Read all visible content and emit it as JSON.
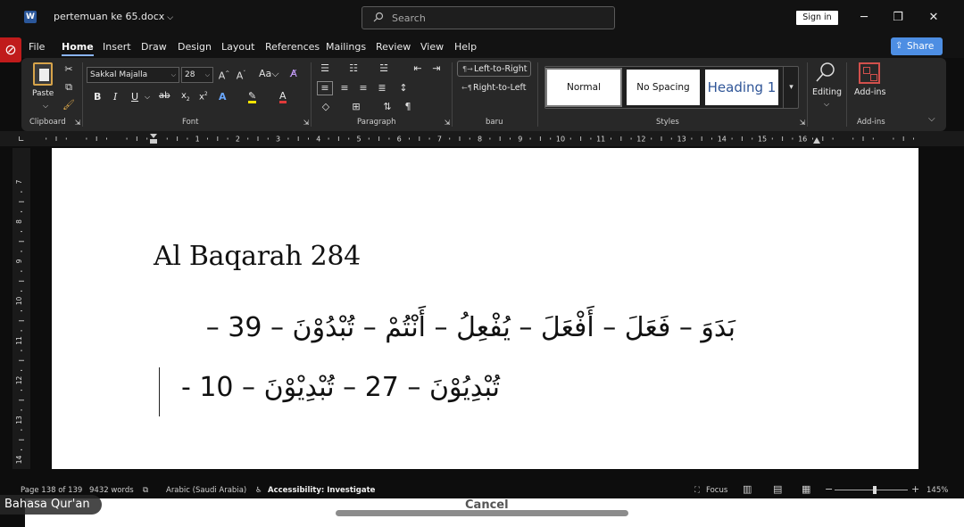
{
  "titlebar": {
    "app_icon": "word-icon",
    "doc_title": "pertemuan ke 65.docx",
    "search_placeholder": "Search",
    "signin_label": "Sign in"
  },
  "menu": {
    "items": [
      "File",
      "Home",
      "Insert",
      "Draw",
      "Design",
      "Layout",
      "References",
      "Mailings",
      "Review",
      "View",
      "Help"
    ],
    "active": "Home",
    "share_label": "Share"
  },
  "ribbon": {
    "clipboard": {
      "paste_label": "Paste",
      "group_label": "Clipboard"
    },
    "font": {
      "name": "Sakkal Majalla",
      "size": "28",
      "group_label": "Font"
    },
    "paragraph": {
      "group_label": "Paragraph"
    },
    "baru": {
      "ltr_label": "Left-to-Right",
      "rtl_label": "Right-to-Left",
      "group_label": "baru"
    },
    "styles": {
      "items": [
        "Normal",
        "No Spacing",
        "Heading 1"
      ],
      "selected": "Normal",
      "group_label": "Styles"
    },
    "editing": {
      "label": "Editing"
    },
    "addins": {
      "label": "Add-ins",
      "group_label": "Add-ins"
    }
  },
  "ruler": {
    "h_numbers": [
      "1",
      "2",
      "3",
      "4",
      "5",
      "6",
      "7",
      "8",
      "9",
      "10",
      "11",
      "12",
      "13",
      "14",
      "15",
      "16"
    ],
    "v_numbers": [
      "7",
      "8",
      "9",
      "10",
      "11",
      "12",
      "13",
      "14"
    ]
  },
  "document": {
    "heading": "Al Baqarah 284",
    "line1": "بَدَوَ – فَعَلَ – أَفْعَلَ – يُفْعِلُ – أَنْتُمْ – تُبْدُوْنَ – 39 –",
    "line2": "تُبْدِيُوْنَ – 27 – تُبْدِيْوْنَ – 10 -"
  },
  "status": {
    "page": "Page 138 of 139",
    "words": "9432 words",
    "language": "Arabic (Saudi Arabia)",
    "accessibility": "Accessibility: Investigate",
    "focus": "Focus",
    "zoom": "145%"
  },
  "overlay": {
    "participant_name": "Bahasa Qur'an",
    "cancel_label": "Cancel"
  }
}
